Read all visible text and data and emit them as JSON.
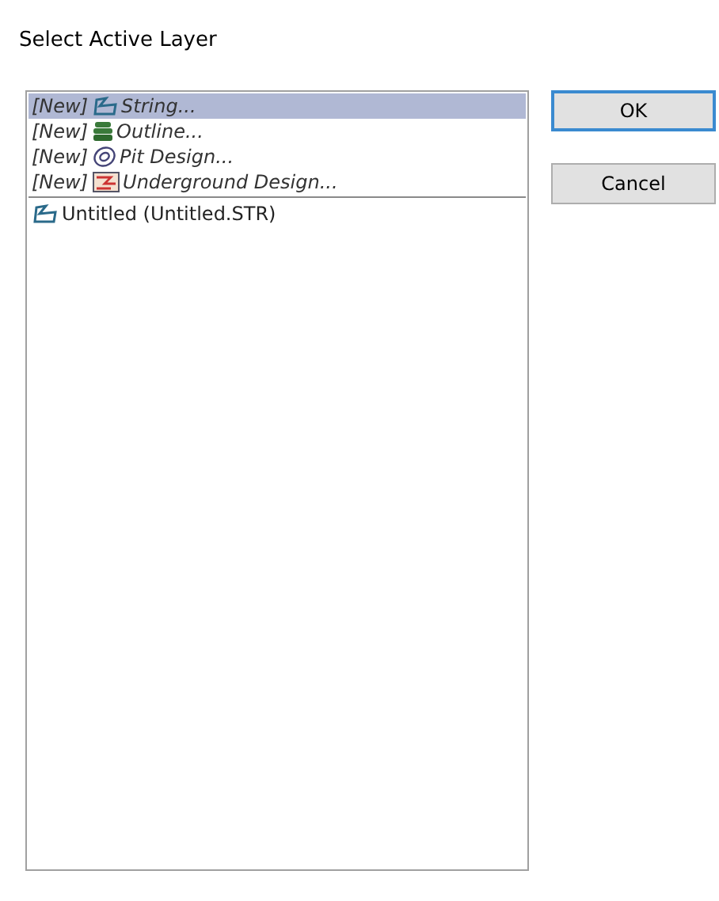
{
  "window": {
    "title": "Select Active Layer"
  },
  "layers": [
    {
      "kind": "string",
      "prefix": "[New]",
      "label": "String...",
      "selected": true
    },
    {
      "kind": "outline",
      "prefix": "[New]",
      "label": "Outline...",
      "selected": false
    },
    {
      "kind": "pit",
      "prefix": "[New]",
      "label": "Pit Design...",
      "selected": false
    },
    {
      "kind": "underground",
      "prefix": "[New]",
      "label": "Underground Design...",
      "selected": false
    },
    {
      "kind": "string",
      "label": "Untitled (Untitled.STR)",
      "selected": false
    }
  ],
  "buttons": [
    {
      "label": "OK",
      "default": true
    },
    {
      "label": "Cancel",
      "default": false
    }
  ]
}
